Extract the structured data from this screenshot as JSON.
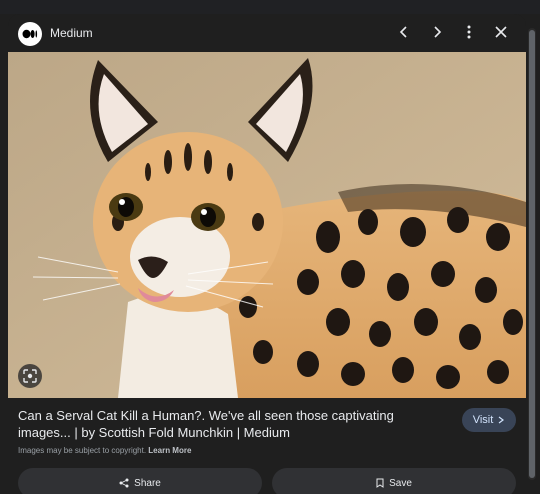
{
  "header": {
    "site_name": "Medium"
  },
  "result": {
    "title": "Can a Serval Cat Kill a Human?. We've all seen those captivating images... | by Scottish Fold Munchkin | Medium",
    "visit_label": "Visit",
    "copyright_text": "Images may be subject to copyright.",
    "learn_more_label": "Learn More"
  },
  "actions": {
    "share_label": "Share",
    "save_label": "Save"
  },
  "icons": {
    "logo": "medium-logo-icon",
    "prev": "chevron-left-icon",
    "next": "chevron-right-icon",
    "more": "more-vert-icon",
    "close": "close-icon",
    "lens": "lens-icon",
    "visit_chevron": "chevron-right-icon",
    "share": "share-icon",
    "save": "bookmark-icon"
  },
  "colors": {
    "background": "#1f1f1f",
    "visit_button": "#394457",
    "action_button": "#303134"
  }
}
